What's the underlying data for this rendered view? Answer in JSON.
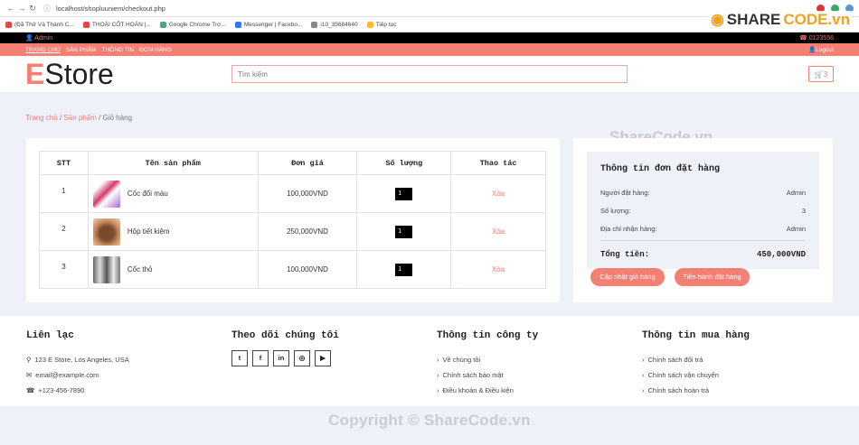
{
  "browser": {
    "url": "localhost/shopluuniem/checkout.php",
    "bookmarks": [
      "(Đã Thử Và Thành C...",
      "THOÁI CỐT HOÁN |...",
      "Google Chrome Trợ...",
      "Messenger | Facebo...",
      "i10_35684640",
      "Tiếp tục"
    ]
  },
  "topbar": {
    "user": "Admin",
    "phone": "0123556"
  },
  "nav": {
    "links": [
      "TRANG CHỦ",
      "SẢN PHẨM",
      "THÔNG TIN",
      "ĐƠN HÀNG"
    ],
    "logout": "Logout"
  },
  "header": {
    "logo_e": "E",
    "logo_rest": "Store",
    "search_placeholder": "Tìm kiếm",
    "cart_count": "3"
  },
  "breadcrumb": {
    "home": "Trang chủ",
    "products": "Sản phẩm",
    "current": "Giỏ hàng"
  },
  "cart_table": {
    "headers": [
      "STT",
      "Tên sản phẩm",
      "Đơn giá",
      "Số lượng",
      "Thao tác"
    ],
    "rows": [
      {
        "stt": "1",
        "name": "Cốc đổi màu",
        "price": "100,000VND",
        "qty": "1",
        "action": "Xóa"
      },
      {
        "stt": "2",
        "name": "Hộp tiết kiệm",
        "price": "250,000VND",
        "qty": "1",
        "action": "Xóa"
      },
      {
        "stt": "3",
        "name": "Cốc thỏ",
        "price": "100,000VND",
        "qty": "1",
        "action": "Xóa"
      }
    ]
  },
  "summary": {
    "title": "Thông tin đơn đặt hàng",
    "orderer_label": "Người đặt hàng:",
    "orderer": "Admin",
    "qty_label": "Số lượng:",
    "qty": "3",
    "address_label": "Địa chỉ nhận hàng:",
    "address": "Admin",
    "total_label": "Tổng tiền:",
    "total": "450,000VND",
    "update_btn": "Cập nhật giỏ hàng",
    "checkout_btn": "Tiến hành đặt hàng"
  },
  "footer": {
    "contact_title": "Liên lạc",
    "address": "123 E Store, Los Angeles, USA",
    "email": "email@example.com",
    "phone": "+123-456-7890",
    "follow_title": "Theo dõi chúng tôi",
    "company_title": "Thông tin công ty",
    "company_links": [
      "Về chúng tôi",
      "Chính sách bảo mật",
      "Điều khoản & Điều kiện"
    ],
    "purchase_title": "Thông tin mua hàng",
    "purchase_links": [
      "Chính sách đổi trả",
      "Chính sách vận chuyển",
      "Chính sách hoàn trả"
    ]
  },
  "watermark": {
    "center": "ShareCode.vn",
    "brand_pre": "SHARE",
    "brand_post": "CODE.vn",
    "copyright": "Copyright © ShareCode.vn"
  },
  "colors": {
    "accent": "#f47f73",
    "topbar": "#000000",
    "page_bg": "#eef1f8"
  }
}
